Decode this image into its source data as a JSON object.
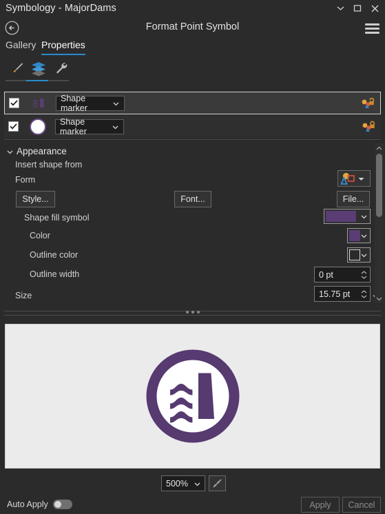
{
  "window": {
    "title": "Symbology - MajorDams",
    "controls": [
      "chevron-down",
      "maximize",
      "close"
    ]
  },
  "header": {
    "panel_title": "Format Point Symbol",
    "back_icon": "back-arrow-icon",
    "menu_icon": "hamburger-menu-icon"
  },
  "tabs": {
    "gallery": "Gallery",
    "properties": "Properties",
    "selected": "Properties"
  },
  "icon_strip": {
    "items": [
      "brush-icon",
      "layers-icon",
      "wrench-icon"
    ],
    "selected_index": 1
  },
  "layers": [
    {
      "checked": true,
      "thumbnail": "dam-marker-thumb",
      "type": "Shape marker",
      "lock": "unlocked-icon"
    },
    {
      "checked": true,
      "thumbnail": "circle-marker-thumb",
      "type": "Shape marker",
      "lock": "locked-icon"
    }
  ],
  "appearance": {
    "section_title": "Appearance",
    "insert_shape_from": "Insert shape from",
    "form_label": "Form",
    "style_button": "Style...",
    "font_button": "Font...",
    "file_button": "File...",
    "shape_fill_symbol_label": "Shape fill symbol",
    "shape_fill_color": "#5a3d75",
    "color_label": "Color",
    "color_value": "#5a3d75",
    "outline_color_label": "Outline color",
    "outline_color_value": "#2b2b2b",
    "outline_width_label": "Outline width",
    "outline_width_value": "0 pt",
    "size_label": "Size",
    "size_value": "15.75 pt"
  },
  "preview": {
    "symbol_name": "major-dam-symbol",
    "symbol_color": "#563a70",
    "background": "#ebebeb"
  },
  "bottom": {
    "zoom_value": "500%",
    "fit_icon": "fit-to-window-icon",
    "auto_apply_label": "Auto Apply",
    "auto_apply_on": false,
    "apply_button": "Apply",
    "cancel_button": "Cancel"
  }
}
